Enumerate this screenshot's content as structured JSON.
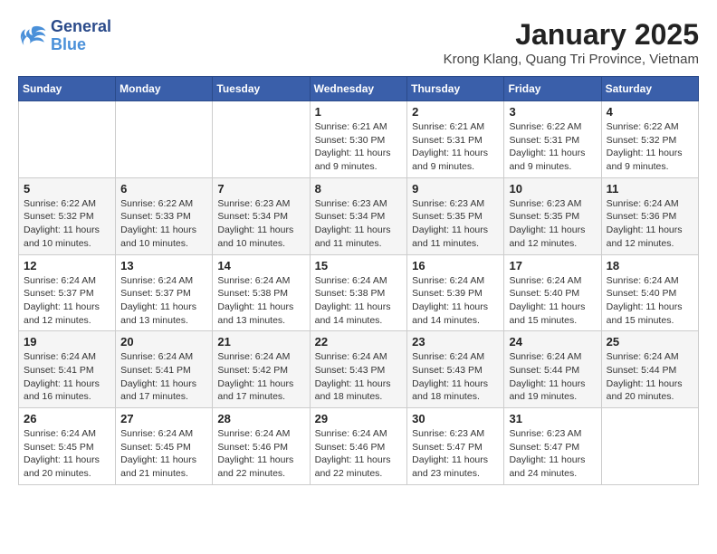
{
  "logo": {
    "line1": "General",
    "line2": "Blue"
  },
  "title": "January 2025",
  "location": "Krong Klang, Quang Tri Province, Vietnam",
  "days_of_week": [
    "Sunday",
    "Monday",
    "Tuesday",
    "Wednesday",
    "Thursday",
    "Friday",
    "Saturday"
  ],
  "weeks": [
    [
      {
        "day": "",
        "info": ""
      },
      {
        "day": "",
        "info": ""
      },
      {
        "day": "",
        "info": ""
      },
      {
        "day": "1",
        "info": "Sunrise: 6:21 AM\nSunset: 5:30 PM\nDaylight: 11 hours and 9 minutes."
      },
      {
        "day": "2",
        "info": "Sunrise: 6:21 AM\nSunset: 5:31 PM\nDaylight: 11 hours and 9 minutes."
      },
      {
        "day": "3",
        "info": "Sunrise: 6:22 AM\nSunset: 5:31 PM\nDaylight: 11 hours and 9 minutes."
      },
      {
        "day": "4",
        "info": "Sunrise: 6:22 AM\nSunset: 5:32 PM\nDaylight: 11 hours and 9 minutes."
      }
    ],
    [
      {
        "day": "5",
        "info": "Sunrise: 6:22 AM\nSunset: 5:32 PM\nDaylight: 11 hours and 10 minutes."
      },
      {
        "day": "6",
        "info": "Sunrise: 6:22 AM\nSunset: 5:33 PM\nDaylight: 11 hours and 10 minutes."
      },
      {
        "day": "7",
        "info": "Sunrise: 6:23 AM\nSunset: 5:34 PM\nDaylight: 11 hours and 10 minutes."
      },
      {
        "day": "8",
        "info": "Sunrise: 6:23 AM\nSunset: 5:34 PM\nDaylight: 11 hours and 11 minutes."
      },
      {
        "day": "9",
        "info": "Sunrise: 6:23 AM\nSunset: 5:35 PM\nDaylight: 11 hours and 11 minutes."
      },
      {
        "day": "10",
        "info": "Sunrise: 6:23 AM\nSunset: 5:35 PM\nDaylight: 11 hours and 12 minutes."
      },
      {
        "day": "11",
        "info": "Sunrise: 6:24 AM\nSunset: 5:36 PM\nDaylight: 11 hours and 12 minutes."
      }
    ],
    [
      {
        "day": "12",
        "info": "Sunrise: 6:24 AM\nSunset: 5:37 PM\nDaylight: 11 hours and 12 minutes."
      },
      {
        "day": "13",
        "info": "Sunrise: 6:24 AM\nSunset: 5:37 PM\nDaylight: 11 hours and 13 minutes."
      },
      {
        "day": "14",
        "info": "Sunrise: 6:24 AM\nSunset: 5:38 PM\nDaylight: 11 hours and 13 minutes."
      },
      {
        "day": "15",
        "info": "Sunrise: 6:24 AM\nSunset: 5:38 PM\nDaylight: 11 hours and 14 minutes."
      },
      {
        "day": "16",
        "info": "Sunrise: 6:24 AM\nSunset: 5:39 PM\nDaylight: 11 hours and 14 minutes."
      },
      {
        "day": "17",
        "info": "Sunrise: 6:24 AM\nSunset: 5:40 PM\nDaylight: 11 hours and 15 minutes."
      },
      {
        "day": "18",
        "info": "Sunrise: 6:24 AM\nSunset: 5:40 PM\nDaylight: 11 hours and 15 minutes."
      }
    ],
    [
      {
        "day": "19",
        "info": "Sunrise: 6:24 AM\nSunset: 5:41 PM\nDaylight: 11 hours and 16 minutes."
      },
      {
        "day": "20",
        "info": "Sunrise: 6:24 AM\nSunset: 5:41 PM\nDaylight: 11 hours and 17 minutes."
      },
      {
        "day": "21",
        "info": "Sunrise: 6:24 AM\nSunset: 5:42 PM\nDaylight: 11 hours and 17 minutes."
      },
      {
        "day": "22",
        "info": "Sunrise: 6:24 AM\nSunset: 5:43 PM\nDaylight: 11 hours and 18 minutes."
      },
      {
        "day": "23",
        "info": "Sunrise: 6:24 AM\nSunset: 5:43 PM\nDaylight: 11 hours and 18 minutes."
      },
      {
        "day": "24",
        "info": "Sunrise: 6:24 AM\nSunset: 5:44 PM\nDaylight: 11 hours and 19 minutes."
      },
      {
        "day": "25",
        "info": "Sunrise: 6:24 AM\nSunset: 5:44 PM\nDaylight: 11 hours and 20 minutes."
      }
    ],
    [
      {
        "day": "26",
        "info": "Sunrise: 6:24 AM\nSunset: 5:45 PM\nDaylight: 11 hours and 20 minutes."
      },
      {
        "day": "27",
        "info": "Sunrise: 6:24 AM\nSunset: 5:45 PM\nDaylight: 11 hours and 21 minutes."
      },
      {
        "day": "28",
        "info": "Sunrise: 6:24 AM\nSunset: 5:46 PM\nDaylight: 11 hours and 22 minutes."
      },
      {
        "day": "29",
        "info": "Sunrise: 6:24 AM\nSunset: 5:46 PM\nDaylight: 11 hours and 22 minutes."
      },
      {
        "day": "30",
        "info": "Sunrise: 6:23 AM\nSunset: 5:47 PM\nDaylight: 11 hours and 23 minutes."
      },
      {
        "day": "31",
        "info": "Sunrise: 6:23 AM\nSunset: 5:47 PM\nDaylight: 11 hours and 24 minutes."
      },
      {
        "day": "",
        "info": ""
      }
    ]
  ]
}
